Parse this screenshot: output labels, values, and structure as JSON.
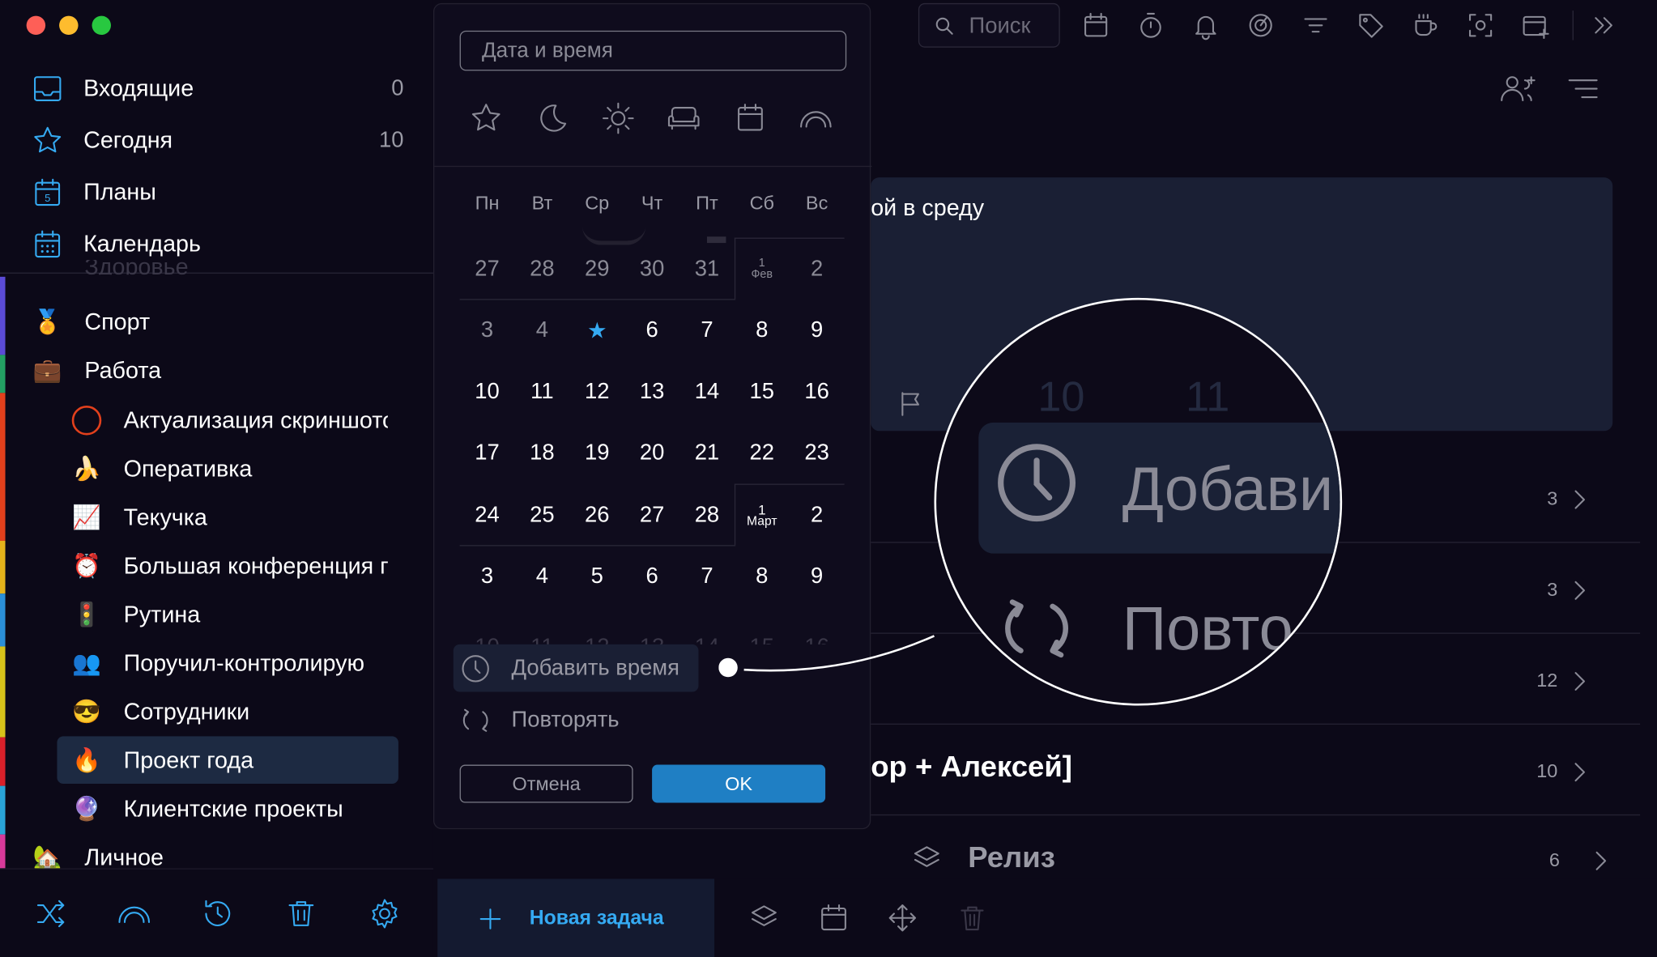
{
  "sidebar": {
    "nav": [
      {
        "label": "Входящие",
        "count": "0"
      },
      {
        "label": "Сегодня",
        "count": "10"
      },
      {
        "label": "Планы",
        "count": ""
      },
      {
        "label": "Календарь",
        "count": ""
      }
    ],
    "hidden_item": "Здоровье",
    "areas": [
      {
        "emoji": "🏅",
        "label": "Спорт"
      },
      {
        "emoji": "💼",
        "label": "Работа"
      }
    ],
    "projects": [
      {
        "emoji": "",
        "label": "Актуализация скриншотов"
      },
      {
        "emoji": "🍌",
        "label": "Оперативка"
      },
      {
        "emoji": "📈",
        "label": "Текучка"
      },
      {
        "emoji": "⏰",
        "label": "Большая конференция по"
      },
      {
        "emoji": "🚦",
        "label": "Рутина"
      },
      {
        "emoji": "👥",
        "label": "Поручил-контролирую"
      },
      {
        "emoji": "😎",
        "label": "Сотрудники"
      },
      {
        "emoji": "🔥",
        "label": "Проект года"
      },
      {
        "emoji": "🔮",
        "label": "Клиентские проекты"
      }
    ],
    "personal": {
      "emoji": "🏡",
      "label": "Личное"
    },
    "colors": {
      "selected_bg": "#1d2a42",
      "accent": "#35aaf2"
    }
  },
  "popup": {
    "input_placeholder": "Дата и время",
    "quick_icons": [
      "star-icon",
      "moon-icon",
      "sun-icon",
      "sofa-icon",
      "calendar-icon",
      "rainbow-icon"
    ],
    "weekdays": [
      "Пн",
      "Вт",
      "Ср",
      "Чт",
      "Пт",
      "Сб",
      "Вс"
    ],
    "weeks": [
      [
        "27",
        "28",
        "29",
        "30",
        "31",
        "1",
        "2"
      ],
      [
        "3",
        "4",
        "★",
        "6",
        "7",
        "8",
        "9"
      ],
      [
        "10",
        "11",
        "12",
        "13",
        "14",
        "15",
        "16"
      ],
      [
        "17",
        "18",
        "19",
        "20",
        "21",
        "22",
        "23"
      ],
      [
        "24",
        "25",
        "26",
        "27",
        "28",
        "1",
        "2"
      ],
      [
        "3",
        "4",
        "5",
        "6",
        "7",
        "8",
        "9"
      ]
    ],
    "faded_week": [
      "10",
      "11",
      "12",
      "13",
      "14",
      "15",
      "16"
    ],
    "month_feb": "Фев",
    "month_mar": "Март",
    "add_time": "Добавить время",
    "repeat": "Повторять",
    "cancel": "Отмена",
    "ok": "OK"
  },
  "main": {
    "search_placeholder": "Поиск",
    "task_text": "ой в среду",
    "task_time_1": "10",
    "task_time_2": "11",
    "rows": [
      {
        "title": "",
        "count": "3"
      },
      {
        "title": "",
        "count": "3"
      },
      {
        "title": "",
        "count": "12"
      },
      {
        "title": "ор + Алексей]",
        "count": "10"
      },
      {
        "title": "Релиз",
        "count": "6"
      }
    ],
    "new_task": "Новая задача"
  },
  "zoom": {
    "add_time": "Добави",
    "repeat": "Повто"
  }
}
